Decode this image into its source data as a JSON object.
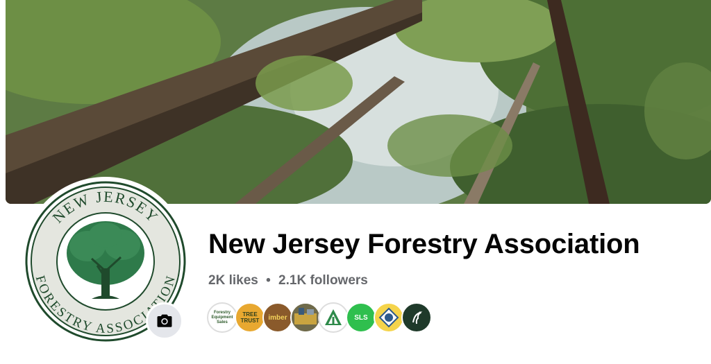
{
  "page": {
    "title": "New Jersey Forestry Association",
    "likes": "2K likes",
    "separator": "•",
    "followers": "2.1K followers"
  },
  "logo": {
    "top_text": "NEW JERSEY",
    "bottom_text": "FORESTRY ASSOCIATION",
    "colors": {
      "ring": "#1f4a2c",
      "tree": "#2e7a4a",
      "field": "#d9dcd2"
    }
  },
  "mutuals": [
    {
      "name": "forestry-equipment-sales",
      "text": "Forestry Equipment Sales"
    },
    {
      "name": "tree-trust",
      "text": "TREE TRUST"
    },
    {
      "name": "imber",
      "text": "imber"
    },
    {
      "name": "sawmill",
      "text": ""
    },
    {
      "name": "triangle-tree-logo",
      "text": ""
    },
    {
      "name": "sls",
      "text": "SLS"
    },
    {
      "name": "badge-logo",
      "text": ""
    },
    {
      "name": "bird-logo",
      "text": ""
    }
  ],
  "icons": {
    "camera": "camera-icon"
  }
}
